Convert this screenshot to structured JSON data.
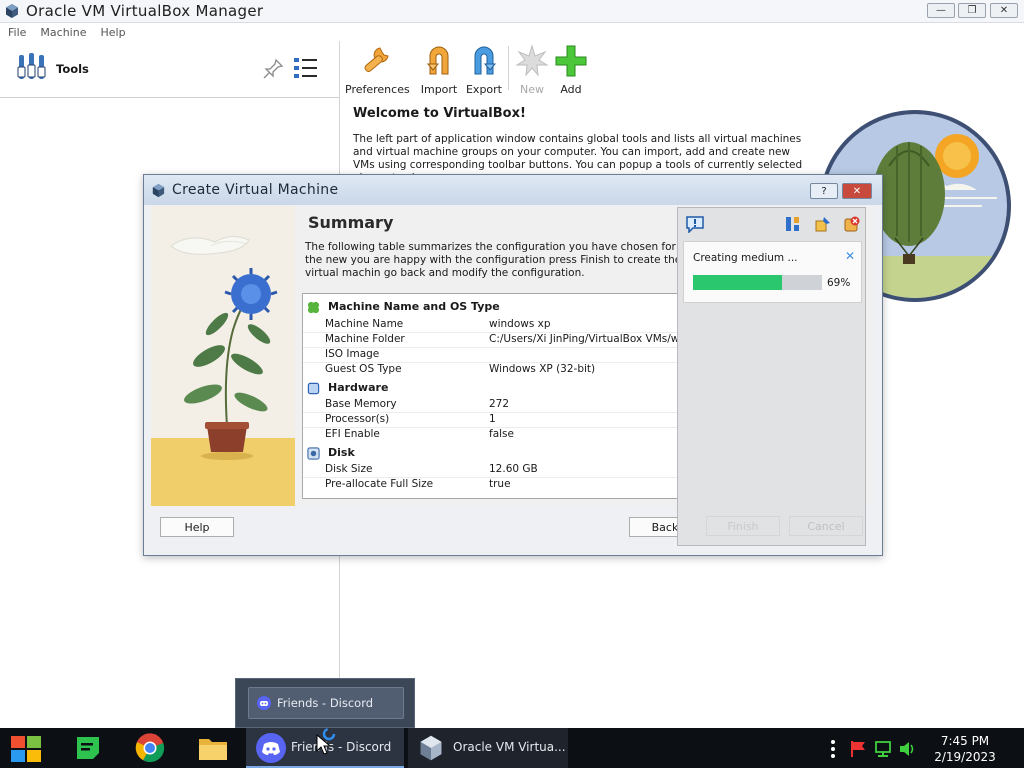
{
  "window": {
    "title": "Oracle VM VirtualBox Manager",
    "minimize": "—",
    "maximize": "❐",
    "close": "✕"
  },
  "menu": [
    "File",
    "Machine",
    "Help"
  ],
  "tools": {
    "label": "Tools"
  },
  "toolbar": {
    "preferences": "Preferences",
    "import": "Import",
    "export": "Export",
    "new": "New",
    "add": "Add"
  },
  "welcome": {
    "title": "Welcome to VirtualBox!",
    "text": "The left part of application window contains global tools and lists all virtual machines and virtual machine groups on your computer. You can import, add and create new VMs using corresponding toolbar buttons. You can popup a tools of currently selected element using"
  },
  "dialog": {
    "title": "Create Virtual Machine",
    "help_btn": "?",
    "close_btn": "✕",
    "summary_title": "Summary",
    "summary_desc": "The following table summarizes the configuration you have chosen for the new you are happy with the configuration press Finish to create the virtual machin go back and modify the configuration.",
    "sections": {
      "name_os": "Machine Name and OS Type",
      "hardware": "Hardware",
      "disk": "Disk"
    },
    "rows": {
      "machine_name": {
        "k": "Machine Name",
        "v": "windows xp"
      },
      "machine_folder": {
        "k": "Machine Folder",
        "v": "C:/Users/Xi JinPing/VirtualBox VMs/windows xp"
      },
      "iso_image": {
        "k": "ISO Image",
        "v": ""
      },
      "guest_os": {
        "k": "Guest OS Type",
        "v": "Windows XP (32-bit)"
      },
      "base_memory": {
        "k": "Base Memory",
        "v": "272"
      },
      "processors": {
        "k": "Processor(s)",
        "v": "1"
      },
      "efi": {
        "k": "EFI Enable",
        "v": "false"
      },
      "disk_size": {
        "k": "Disk Size",
        "v": "12.60 GB"
      },
      "prealloc": {
        "k": "Pre-allocate Full Size",
        "v": "true"
      }
    },
    "buttons": {
      "help": "Help",
      "back": "Back",
      "finish": "Finish",
      "cancel": "Cancel"
    }
  },
  "notification": {
    "message": "Creating medium ...",
    "progress_text": "69%",
    "progress": 0.69,
    "colors": {
      "bar": "#2bc76e"
    }
  },
  "popup": {
    "label": "Friends - Discord"
  },
  "taskbar": {
    "discord_label": "Friends - Discord",
    "vbox_label": "Oracle VM Virtua...",
    "time": "7:45 PM",
    "date": "2/19/2023"
  }
}
